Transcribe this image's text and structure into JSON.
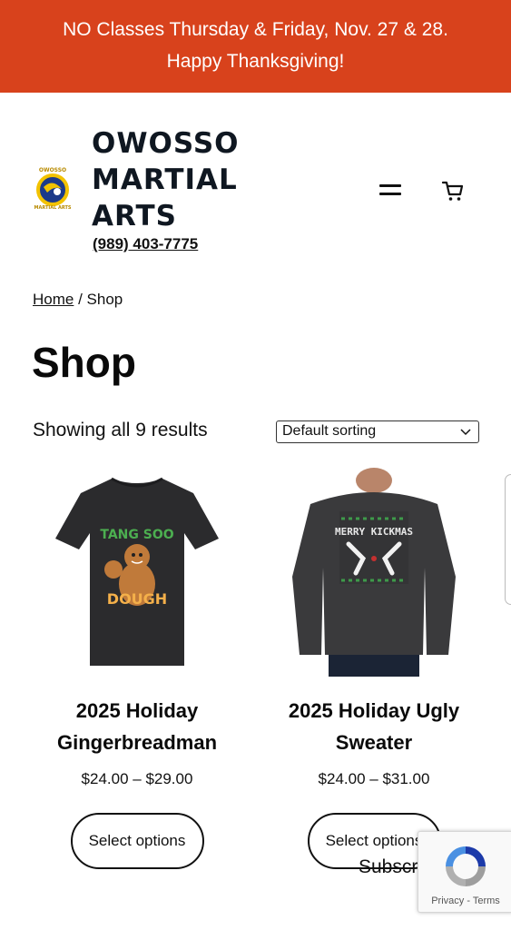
{
  "announcement": {
    "line1": "NO Classes Thursday & Friday, Nov. 27 & 28.",
    "line2": "Happy Thanksgiving!"
  },
  "header": {
    "brand_line1": "OWOSSO",
    "brand_line2": "MARTIAL",
    "brand_line3": "ARTS",
    "phone": "(989) 403-7775",
    "logo_text": "OWOSSO MARTIAL ARTS"
  },
  "breadcrumb": {
    "home": "Home",
    "separator": " / ",
    "current": "Shop"
  },
  "page": {
    "title": "Shop",
    "result_count": "Showing all 9 results",
    "sort_selected": "Default sorting"
  },
  "products": [
    {
      "title_line1": "2025 Holiday",
      "title_line2": "Gingerbreadman",
      "price": "$24.00 – $29.00",
      "button": "Select options",
      "shirt_text_top": "TANG SOO",
      "shirt_text_bottom": "DOUGH"
    },
    {
      "title_line1": "2025 Holiday Ugly",
      "title_line2": "Sweater",
      "price": "$24.00 – $31.00",
      "button": "Select options",
      "sweater_text": "MERRY KICKMAS"
    }
  ],
  "overlay": {
    "subscribe": "Subscribe",
    "recaptcha_privacy": "Privacy",
    "recaptcha_sep": " - ",
    "recaptcha_terms": "Terms"
  },
  "colors": {
    "banner": "#d8421c",
    "text": "#111111",
    "brand": "#0f1721"
  }
}
